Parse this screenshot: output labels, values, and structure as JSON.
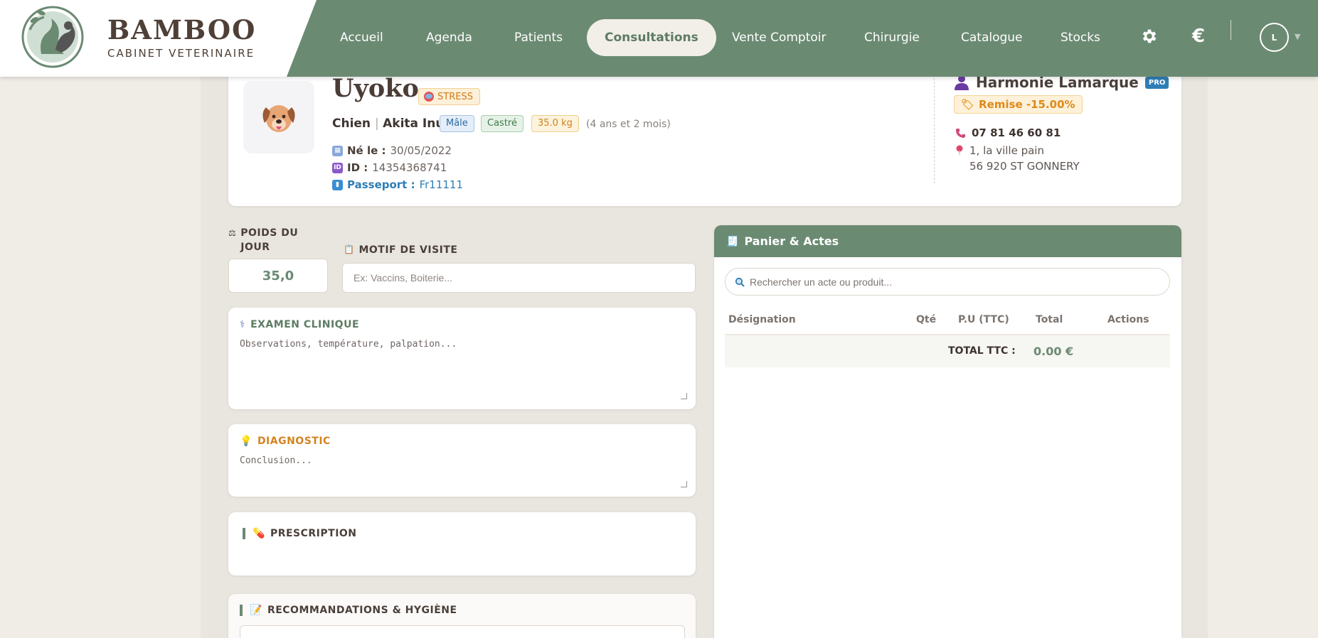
{
  "brand": {
    "name": "BAMBOO",
    "subtitle": "CABINET VETERINAIRE"
  },
  "nav": {
    "items": [
      {
        "label": "Accueil"
      },
      {
        "label": "Agenda"
      },
      {
        "label": "Patients"
      },
      {
        "label": "Consultations",
        "active": true
      },
      {
        "label": "Vente Comptoir"
      },
      {
        "label": "Chirurgie"
      },
      {
        "label": "Catalogue"
      },
      {
        "label": "Stocks"
      }
    ],
    "icons": [
      "gear-icon",
      "euro-icon"
    ],
    "euro_symbol": "€",
    "user_initial": "L"
  },
  "patient": {
    "name": "Uyoko",
    "behavior_badge": "STRESS",
    "species": "Chien",
    "breed": "Akita Inu",
    "sex": "Mâle",
    "status": "Castré",
    "weight": "35.0 kg",
    "age": "(4 ans et 2 mois)",
    "birth_label": "Né le :",
    "birth_date": "30/05/2022",
    "id_label": "ID :",
    "id_value": "14354368741",
    "passport_label": "Passeport :",
    "passport_value": "Fr11111"
  },
  "owner": {
    "name": "Harmonie Lamarque",
    "badge": "PRO",
    "discount": "Remise -15.00%",
    "phone": "07 81 46 60 81",
    "address_line1": "1, la ville pain",
    "address_line2": "56 920 ST GONNERY"
  },
  "form": {
    "weight_label": "POIDS DU JOUR",
    "weight_value": "35,0",
    "motif_label": "MOTIF DE VISITE",
    "motif_placeholder": "Ex: Vaccins, Boiterie...",
    "exam_label": "EXAMEN CLINIQUE",
    "exam_placeholder": "Observations, température, palpation...",
    "diag_label": "DIAGNOSTIC",
    "diag_placeholder": "Conclusion...",
    "prescription_label": "PRESCRIPTION",
    "reco_label": "RECOMMANDATIONS & HYGIÈNE"
  },
  "panier": {
    "title": "Panier & Actes",
    "search_placeholder": "Rechercher un acte ou produit...",
    "columns": [
      "Désignation",
      "Qté",
      "P.U (TTC)",
      "Total",
      "Actions"
    ],
    "total_label": "TOTAL TTC :",
    "total_value": "0.00 €"
  },
  "colors": {
    "primary": "#6b8a72",
    "accent_orange": "#de8a1a",
    "link_blue": "#2f7db5",
    "background": "#f0ece6"
  }
}
